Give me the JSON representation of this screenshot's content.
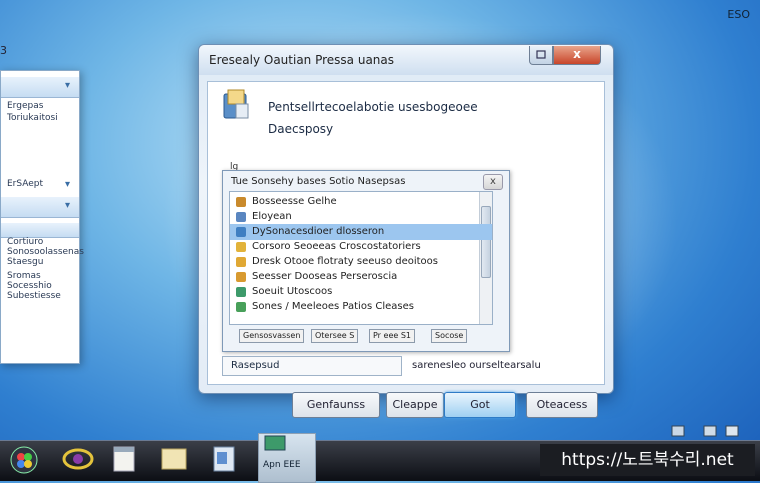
{
  "desktop": {
    "corner_glyph": "3",
    "top_right_label": "ESO"
  },
  "left_window": {
    "items": [
      "Ergepas",
      "Toriukaitosi",
      "ErSAept"
    ],
    "lower_items": [
      "Cortiuro",
      "Sonosoolassenas",
      "Staesgu",
      "Sromas",
      "Socesshio",
      "Subestiesse"
    ]
  },
  "dialog": {
    "title": "Eresealy Oautian Pressa uanas",
    "close_label": "x",
    "header_line1": "Pentsellrtecoelabotie usesbogeoee",
    "header_line2": "Daecsposy",
    "small_label": "lg",
    "panel": {
      "title": "Tue Sonsehy bases Sotio Nasepsas",
      "close_label": "x",
      "rows": [
        {
          "label": "Bosseesse Gelhe",
          "icon_color": "#c98a2c",
          "selected": false
        },
        {
          "label": "Eloyean",
          "icon_color": "#5a86c0",
          "selected": false
        },
        {
          "label": "DySonacesdioer dlosseron",
          "icon_color": "#3f7fc2",
          "selected": true
        },
        {
          "label": "Corsoro Seoeeas Croscostatoriers",
          "icon_color": "#e2b33a",
          "selected": false
        },
        {
          "label": "Dresk Otooe flotraty seeuso deoitoos",
          "icon_color": "#e0a834",
          "selected": false
        },
        {
          "label": "Seesser Dooseas Perseroscia",
          "icon_color": "#d89a30",
          "selected": false
        },
        {
          "label": "Soeuit Utoscoos",
          "icon_color": "#3d9a6a",
          "selected": false
        },
        {
          "label": "Sones / Meeleoes Patios Cleases",
          "icon_color": "#48a05a",
          "selected": false
        }
      ],
      "status_segments": [
        "Gensosvassen",
        "Otersee S",
        "Pr eee S1",
        "Socose"
      ]
    },
    "input_value": "Rasepsud",
    "right_text": "sarenesleo ourseltearsalu",
    "buttons": {
      "b1": "Genfaunss",
      "b2": "Cleappe",
      "b3": "Got",
      "b4": "Oteacess"
    }
  },
  "taskbar": {
    "active_label_line1": "Apn",
    "active_label_line2": "EEE",
    "watermark": "https://노트북수리.net"
  }
}
